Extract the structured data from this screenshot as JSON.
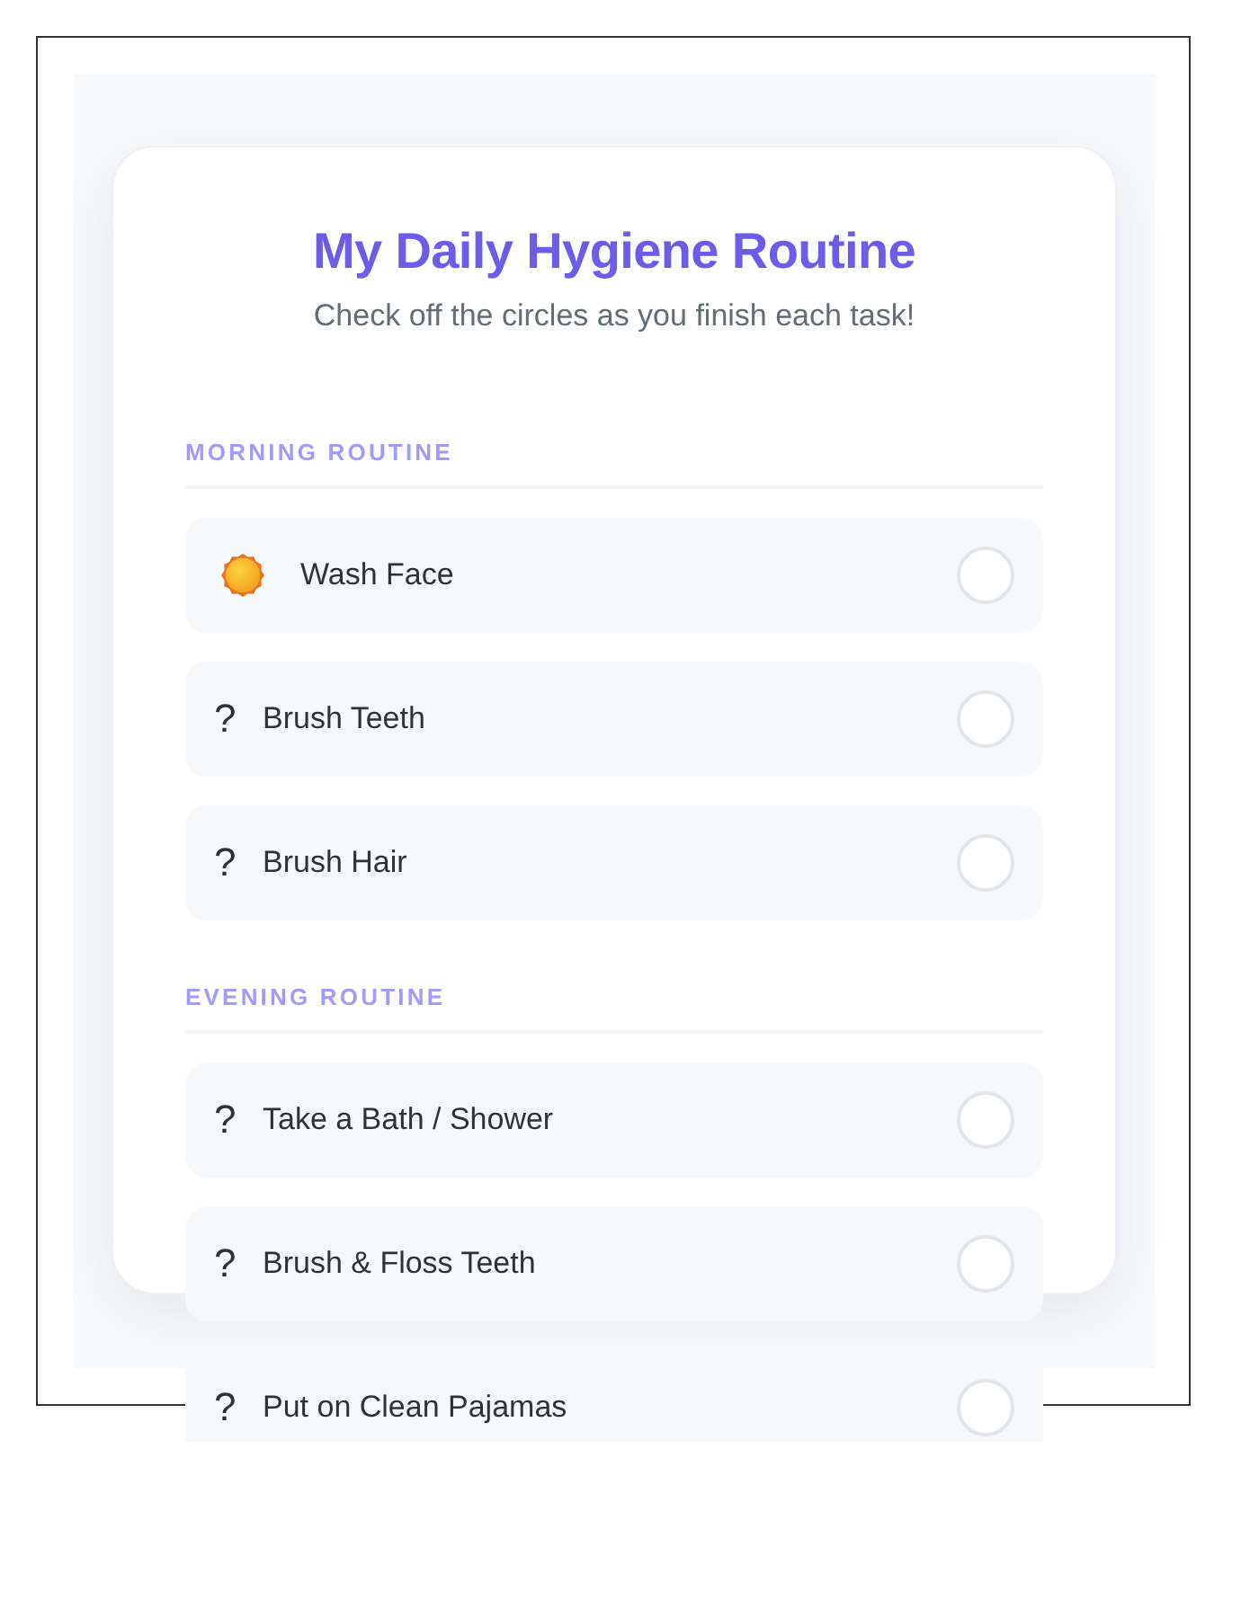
{
  "title": "My Daily Hygiene Routine",
  "subtitle": "Check off the circles as you finish each task!",
  "sections": [
    {
      "heading": "MORNING ROUTINE",
      "tasks": [
        {
          "kind": "icon",
          "label": "Wash Face",
          "checked": false
        },
        {
          "kind": "glyph",
          "glyph": "?",
          "label": "Brush Teeth",
          "checked": false
        },
        {
          "kind": "glyph",
          "glyph": "?",
          "label": "Brush Hair",
          "checked": false
        }
      ]
    },
    {
      "heading": "EVENING ROUTINE",
      "tasks": [
        {
          "kind": "glyph",
          "glyph": "?",
          "label": "Take a Bath / Shower",
          "checked": false
        },
        {
          "kind": "glyph",
          "glyph": "?",
          "label": "Brush & Floss Teeth",
          "checked": false
        },
        {
          "kind": "glyph",
          "glyph": "?",
          "label": "Put on Clean Pajamas",
          "checked": false
        }
      ]
    }
  ]
}
